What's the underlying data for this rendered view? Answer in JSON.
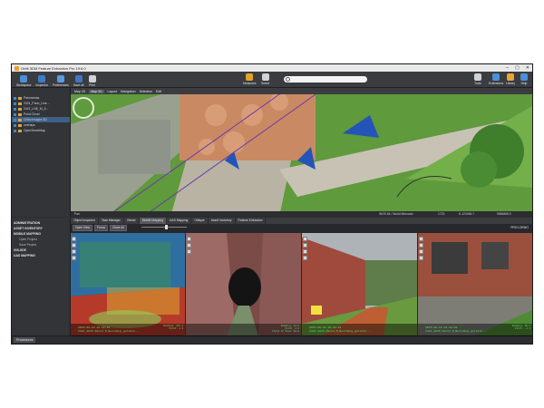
{
  "window": {
    "title": "Orbit 3DM Feature Extraction Pro 19.6.0",
    "controls": [
      "–",
      "▢",
      "✕"
    ]
  },
  "ribbon": {
    "left": [
      "Workspace",
      "Inspector",
      "Preferences",
      "Save all",
      "Print"
    ],
    "mid": [
      "Measures",
      "Select"
    ],
    "right": [
      "Tools",
      "Extensions",
      "Library",
      "Help"
    ],
    "search_placeholder": ""
  },
  "layers": [
    "Panoramas",
    "2421_Pano_Line...",
    "2421_LNE_M_6...",
    "Point Cloud",
    "Ortho Images 3D",
    "overlays",
    "OpenStreetMap"
  ],
  "map": {
    "tabs": [
      "Map 2D",
      "Map 3D",
      "Layout",
      "Navigation",
      "Selection",
      "Edit"
    ],
    "status": [
      "Pan",
      "WGS 84 / World Mercator",
      "1723",
      "E-123456.7",
      "5556868.9"
    ]
  },
  "tree": [
    {
      "label": "ADMINISTRATION",
      "kind": "bold"
    },
    {
      "label": "ASSET INVENTORY",
      "kind": "bold"
    },
    {
      "label": "MOBILE MAPPING",
      "kind": "bold"
    },
    {
      "label": "Open Project",
      "kind": "sub"
    },
    {
      "label": "Save Project",
      "kind": "sub"
    },
    {
      "label": "GIS-SDE",
      "kind": "bold"
    },
    {
      "label": "UAS MAPPING",
      "kind": "bold"
    }
  ],
  "panel": {
    "tabs": [
      "Object Inspector",
      "Task Manager",
      "Viewer",
      "Mobile Mapping",
      "UAS Mapping",
      "Oblique",
      "Asset Inventory",
      "Feature Extraction"
    ],
    "toolbar": [
      "Open View",
      "Focus",
      "Close all"
    ],
    "right_tag": "PRO1.DEMO"
  },
  "viewports": [
    {
      "left": [
        "2015-06-18 15:42:18",
        "2421_2015_Pano4_M_Building_gelatin..."
      ],
      "right": [
        "Heading: 241.1",
        "Pitch: 1.3",
        "Field of View: 120.0"
      ]
    },
    {
      "left": [
        "",
        ""
      ],
      "right": [
        "Heading: 12.6",
        "Pitch: 2.4",
        "Field of View: 90.0"
      ]
    },
    {
      "left": [
        "2015-06-18 15:42:18",
        "2421_2015_Pano4_M_Building_gelatin..."
      ],
      "right": [
        "Heading: 75.1",
        "Pitch: 0.3",
        "Field of View: 60.0"
      ]
    },
    {
      "left": [
        "2015-06-18 15:42:18",
        "2421_2015_Pano4_M_Building_gelatin..."
      ],
      "right": [
        "Heading: 90.2",
        "Pitch: -1.3",
        "Field of View: 60.0"
      ]
    }
  ],
  "bottom_tab": "Procedures",
  "colors": {
    "accent": "#3e5f86",
    "caption": "#5ee06b",
    "chrome": "#2b2d30"
  }
}
